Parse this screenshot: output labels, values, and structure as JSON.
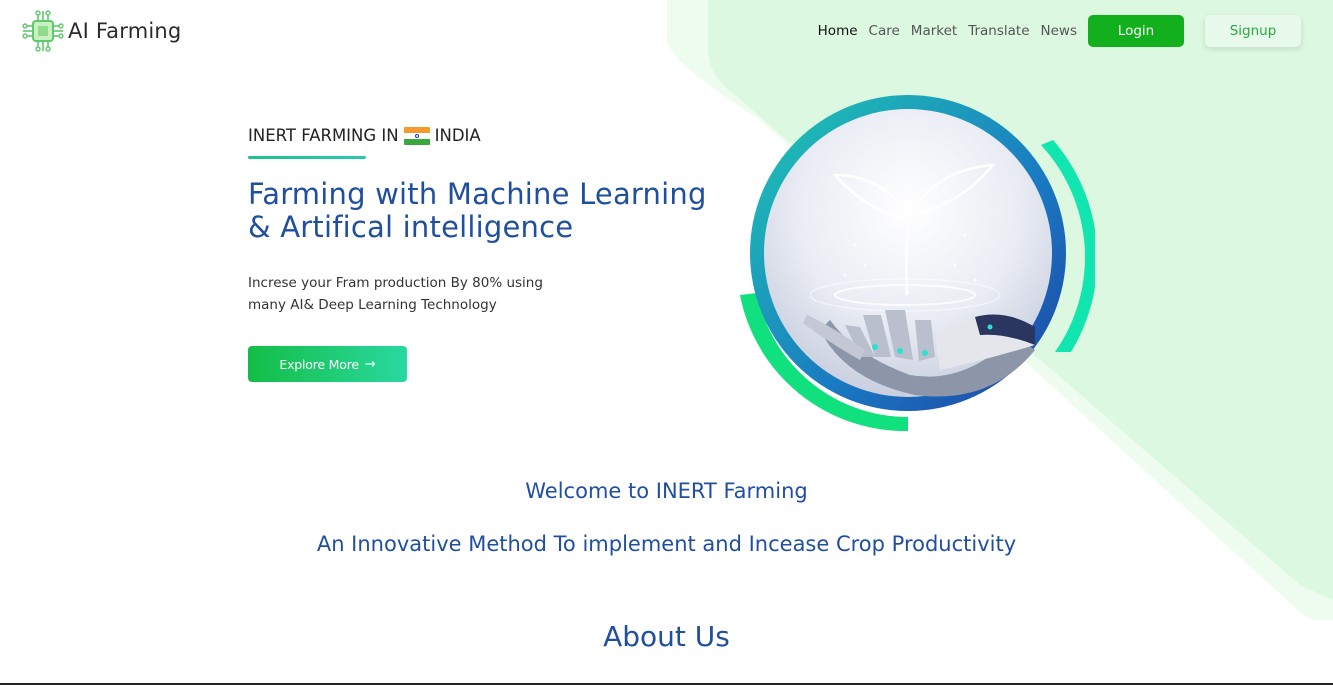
{
  "header": {
    "logo_text": "AI Farming",
    "nav": {
      "home": "Home",
      "care": "Care",
      "market": "Market",
      "translate": "Translate",
      "news": "News"
    },
    "login_label": "Login",
    "signup_label": "Signup"
  },
  "hero": {
    "eyebrow_prefix": "INERT FARMING IN",
    "eyebrow_suffix": "INDIA",
    "title_line1": "Farming with Machine Learning",
    "title_line2": "& Artifical intelligence",
    "subtitle_line1": "Increse your Fram production By 80% using",
    "subtitle_line2": "many AI& Deep Learning Technology",
    "explore_label": "Explore More",
    "explore_icon": "arrow-right-icon",
    "image_icon": "robot-hand-plant-image"
  },
  "welcome": {
    "heading": "Welcome to INERT Farming",
    "tagline": "An Innovative Method To implement and Incease Crop Productivity"
  },
  "about": {
    "heading": "About Us"
  },
  "colors": {
    "brand_green": "#11b01c",
    "heading_blue": "#1f4f9e",
    "bg_mint": "#dcf8e0"
  }
}
